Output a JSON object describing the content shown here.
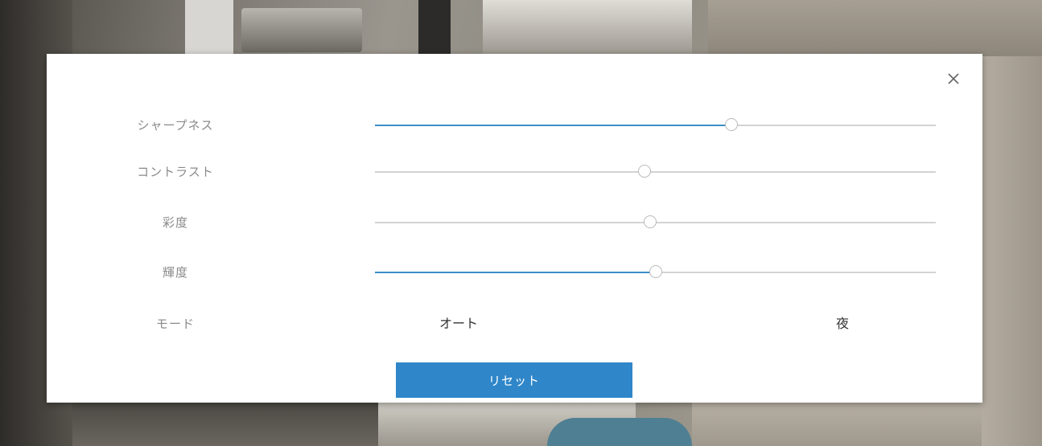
{
  "dialog": {
    "sliders": [
      {
        "label": "シャープネス",
        "value_pct": 63.5,
        "fill": true
      },
      {
        "label": "コントラスト",
        "value_pct": 48.0,
        "fill": false
      },
      {
        "label": "彩度",
        "value_pct": 49.0,
        "fill": false
      },
      {
        "label": "輝度",
        "value_pct": 50.0,
        "fill": true
      }
    ],
    "mode": {
      "label": "モード",
      "options": [
        "オート",
        "夜"
      ]
    },
    "reset_label": "リセット",
    "close_icon": "close-icon",
    "colors": {
      "accent": "#3a8fc9",
      "button": "#2f86c9",
      "track": "#d3d3d3",
      "label": "#8a8a8a"
    }
  }
}
